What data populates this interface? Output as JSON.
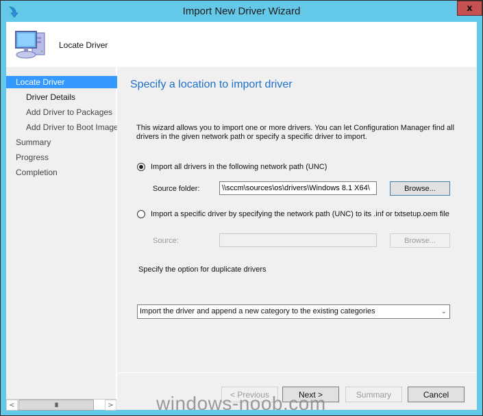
{
  "window": {
    "title": "Import New Driver Wizard",
    "close_label": "x"
  },
  "header": {
    "title": "Locate Driver"
  },
  "sidebar": {
    "items": [
      {
        "label": "Locate Driver"
      },
      {
        "label": "Driver Details"
      },
      {
        "label": "Add Driver to Packages"
      },
      {
        "label": "Add Driver to Boot Images"
      },
      {
        "label": "Summary"
      },
      {
        "label": "Progress"
      },
      {
        "label": "Completion"
      }
    ],
    "scroll_left": "<",
    "scroll_right": ">",
    "scroll_thumb": "III"
  },
  "main": {
    "title": "Specify a location to import driver",
    "description": "This wizard allows you to import one or more drivers. You can let Configuration Manager find all drivers in the given network path or specify a specific driver to import.",
    "option_all": {
      "label": "Import all drivers in the following network path (UNC)",
      "checked": true,
      "source_label": "Source folder:",
      "source_value": "\\\\sccm\\sources\\os\\drivers\\Windows 8.1 X64\\",
      "browse_label": "Browse..."
    },
    "option_specific": {
      "label": "Import a specific driver by specifying the network path (UNC) to its .inf or txtsetup.oem file",
      "checked": false,
      "source_label": "Source:",
      "source_value": "",
      "browse_label": "Browse..."
    },
    "duplicate_label": "Specify the option for duplicate drivers",
    "duplicate_selected": "Import the driver and append a new category to the existing categories"
  },
  "footer": {
    "previous_label": "< Previous",
    "next_label": "Next >",
    "summary_label": "Summary",
    "cancel_label": "Cancel"
  },
  "watermark": "windows-noob.com"
}
